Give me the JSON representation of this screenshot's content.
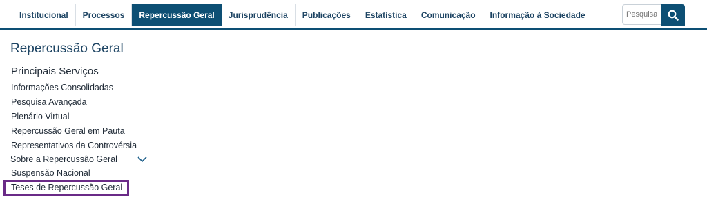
{
  "nav": {
    "items": [
      {
        "label": "Institucional"
      },
      {
        "label": "Processos"
      },
      {
        "label": "Repercussão Geral",
        "active": true
      },
      {
        "label": "Jurisprudência"
      },
      {
        "label": "Publicações"
      },
      {
        "label": "Estatística"
      },
      {
        "label": "Comunicação"
      },
      {
        "label": "Informação à Sociedade"
      }
    ],
    "search_placeholder": "Pesquisar"
  },
  "page": {
    "title": "Repercussão Geral",
    "section_title": "Principais Serviços",
    "menu": [
      {
        "label": "Informações Consolidadas"
      },
      {
        "label": "Pesquisa Avançada"
      },
      {
        "label": "Plenário Virtual"
      },
      {
        "label": "Repercussão Geral em Pauta"
      },
      {
        "label": "Representativos da Controvérsia"
      },
      {
        "label": "Sobre a Repercussão Geral"
      },
      {
        "label": "Suspensão Nacional"
      },
      {
        "label": "Teses de Repercussão Geral",
        "highlighted": true
      }
    ]
  },
  "colors": {
    "brand": "#0d4f74",
    "highlight_border": "#6a2a87"
  },
  "icons": {
    "search": "search-icon",
    "expand": "chevron-down-icon"
  }
}
